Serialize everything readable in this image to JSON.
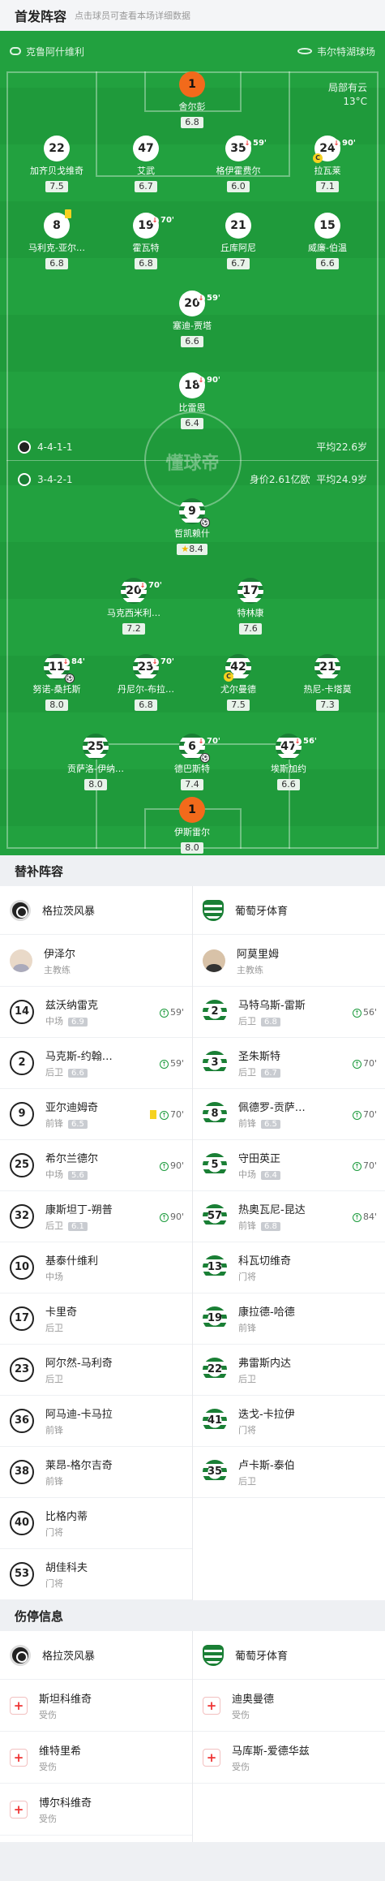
{
  "header": {
    "title": "首发阵容",
    "subtitle": "点击球员可查看本场详细数据"
  },
  "teams": {
    "home": "格拉茨风暴",
    "away": "葡萄牙体育"
  },
  "pitch": {
    "home_team": "克鲁阿什维利",
    "away_team": "韦尔特湖球场",
    "weather": "局部有云",
    "temp": "13°C",
    "watermark": "懂球帝"
  },
  "formations": {
    "home": {
      "formation": "4-4-1-1",
      "avg_age": "平均22.6岁"
    },
    "away": {
      "formation": "3-4-2-1",
      "value": "身价2.61亿欧",
      "avg_age": "平均24.9岁"
    }
  },
  "home_players": [
    {
      "num": "1",
      "name": "舍尔彭",
      "rating": "6.8"
    },
    {
      "num": "22",
      "name": "加齐贝戈维奇",
      "rating": "7.5"
    },
    {
      "num": "47",
      "name": "艾武",
      "rating": "6.7"
    },
    {
      "num": "35",
      "name": "格伊霍费尔",
      "rating": "6.0",
      "sub": "59'"
    },
    {
      "num": "24",
      "name": "拉瓦莱",
      "rating": "7.1",
      "sub": "90'"
    },
    {
      "num": "8",
      "name": "马利克-亚尔…",
      "rating": "6.8"
    },
    {
      "num": "19",
      "name": "霍瓦特",
      "rating": "6.8",
      "sub": "70'"
    },
    {
      "num": "21",
      "name": "丘库阿尼",
      "rating": "6.7"
    },
    {
      "num": "15",
      "name": "威廉-伯温",
      "rating": "6.6"
    },
    {
      "num": "20",
      "name": "塞迪-贾塔",
      "rating": "6.6",
      "sub": "59'"
    },
    {
      "num": "18",
      "name": "比雷恩",
      "rating": "6.4",
      "sub": "90'"
    }
  ],
  "away_players": [
    {
      "num": "9",
      "name": "哲凯赖什",
      "rating": "8.4"
    },
    {
      "num": "20",
      "name": "马克西米利…",
      "rating": "7.2",
      "sub": "70'"
    },
    {
      "num": "17",
      "name": "特林康",
      "rating": "7.6"
    },
    {
      "num": "11",
      "name": "努诺-桑托斯",
      "rating": "8.0",
      "sub": "84'"
    },
    {
      "num": "23",
      "name": "丹尼尔-布拉…",
      "rating": "6.8",
      "sub": "70'"
    },
    {
      "num": "42",
      "name": "尤尔曼德",
      "rating": "7.5"
    },
    {
      "num": "21",
      "name": "热尼-卡塔莫",
      "rating": "7.3"
    },
    {
      "num": "25",
      "name": "贡萨洛-伊纳…",
      "rating": "8.0"
    },
    {
      "num": "6",
      "name": "德巴斯特",
      "rating": "7.4",
      "sub": "70'"
    },
    {
      "num": "47",
      "name": "埃斯加约",
      "rating": "6.6",
      "sub": "56'"
    },
    {
      "num": "1",
      "name": "伊斯雷尔",
      "rating": "8.0"
    }
  ],
  "subs_section": {
    "title": "替补阵容"
  },
  "coaches": {
    "home": {
      "name": "伊泽尔",
      "role": "主教练"
    },
    "away": {
      "name": "阿莫里姆",
      "role": "主教练"
    }
  },
  "home_subs": [
    {
      "num": "14",
      "name": "兹沃纳雷克",
      "pos": "中场",
      "rating": "6.9",
      "min": "59'"
    },
    {
      "num": "2",
      "name": "马克斯-约翰…",
      "pos": "后卫",
      "rating": "6.6",
      "min": "59'"
    },
    {
      "num": "9",
      "name": "亚尔迪姆奇",
      "pos": "前锋",
      "rating": "6.5",
      "min": "70'"
    },
    {
      "num": "25",
      "name": "希尔兰德尔",
      "pos": "中场",
      "rating": "5.6",
      "min": "90'"
    },
    {
      "num": "32",
      "name": "康斯坦丁-朔普",
      "pos": "后卫",
      "rating": "6.1",
      "min": "90'"
    },
    {
      "num": "10",
      "name": "基泰什维利",
      "pos": "中场"
    },
    {
      "num": "17",
      "name": "卡里奇",
      "pos": "后卫"
    },
    {
      "num": "23",
      "name": "阿尔然-马利奇",
      "pos": "后卫"
    },
    {
      "num": "36",
      "name": "阿马迪-卡马拉",
      "pos": "前锋"
    },
    {
      "num": "38",
      "name": "莱昂-格尔吉奇",
      "pos": "前锋"
    },
    {
      "num": "40",
      "name": "比格内蒂",
      "pos": "门将"
    },
    {
      "num": "53",
      "name": "胡佳科夫",
      "pos": "门将"
    }
  ],
  "away_subs": [
    {
      "num": "2",
      "name": "马特乌斯-雷斯",
      "pos": "后卫",
      "rating": "6.8",
      "min": "56'"
    },
    {
      "num": "3",
      "name": "圣朱斯特",
      "pos": "后卫",
      "rating": "6.7",
      "min": "70'"
    },
    {
      "num": "8",
      "name": "佩德罗-贡萨…",
      "pos": "前锋",
      "rating": "6.5",
      "min": "70'"
    },
    {
      "num": "5",
      "name": "守田英正",
      "pos": "中场",
      "rating": "6.4",
      "min": "70'"
    },
    {
      "num": "57",
      "name": "热奥瓦尼-昆达",
      "pos": "前锋",
      "rating": "6.8",
      "min": "84'"
    },
    {
      "num": "13",
      "name": "科瓦切维奇",
      "pos": "门将"
    },
    {
      "num": "19",
      "name": "康拉德-哈德",
      "pos": "前锋"
    },
    {
      "num": "22",
      "name": "弗雷斯内达",
      "pos": "后卫"
    },
    {
      "num": "41",
      "name": "迭戈-卡拉伊",
      "pos": "门将"
    },
    {
      "num": "35",
      "name": "卢卡斯-泰伯",
      "pos": "后卫"
    }
  ],
  "injury_section": {
    "title": "伤停信息"
  },
  "home_injuries": [
    {
      "name": "斯坦科维奇",
      "status": "受伤"
    },
    {
      "name": "维特里希",
      "status": "受伤"
    },
    {
      "name": "博尔科维奇",
      "status": "受伤"
    }
  ],
  "away_injuries": [
    {
      "name": "迪奥曼德",
      "status": "受伤"
    },
    {
      "name": "马库斯-爱德华兹",
      "status": "受伤"
    }
  ],
  "colors": {
    "pitch": "#1f9a3b",
    "gk": "#f26a1b",
    "sporting_green": "#1a7f35"
  }
}
